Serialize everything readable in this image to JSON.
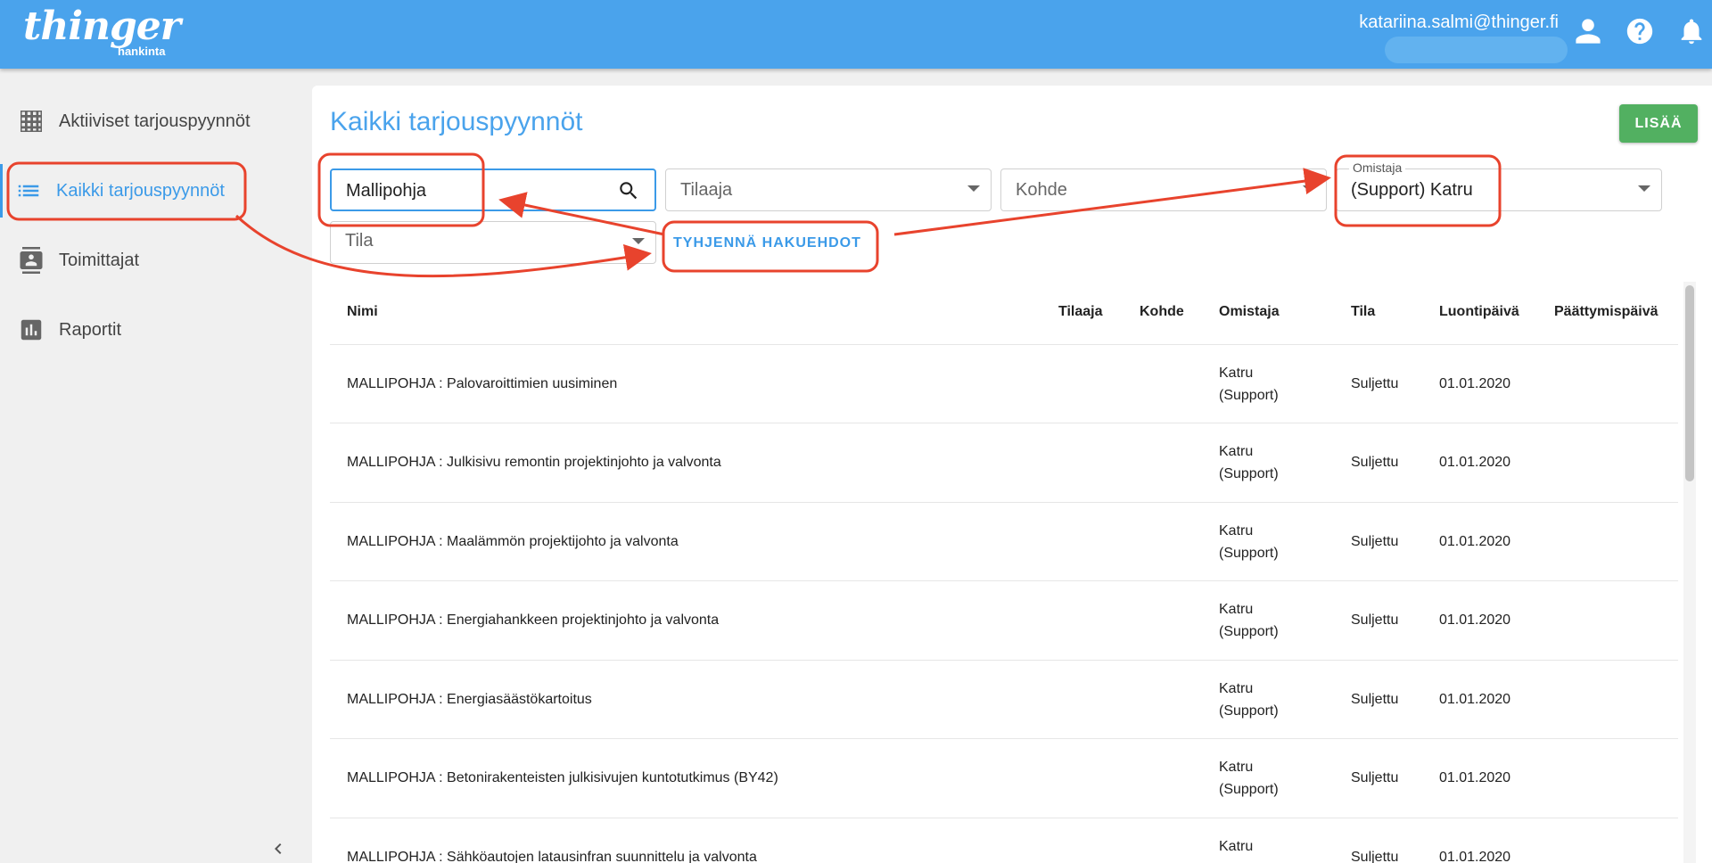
{
  "header": {
    "logo_text": "thinger",
    "logo_sub": "hankinta",
    "user_email": "katariina.salmi@thinger.fi",
    "icons": [
      "account-icon",
      "help-icon",
      "bell-icon"
    ]
  },
  "sidebar": {
    "items": [
      {
        "label": "Aktiiviset tarjouspyynnöt",
        "icon": "grid-icon",
        "active": false
      },
      {
        "label": "Kaikki tarjouspyynnöt",
        "icon": "list-icon",
        "active": true
      },
      {
        "label": "Toimittajat",
        "icon": "contacts-icon",
        "active": false
      },
      {
        "label": "Raportit",
        "icon": "bar-chart-icon",
        "active": false
      }
    ]
  },
  "main": {
    "title": "Kaikki tarjouspyynnöt",
    "add_button": "LISÄÄ",
    "filters": {
      "search_value": "Mallipohja",
      "tilaaja_placeholder": "Tilaaja",
      "kohde_placeholder": "Kohde",
      "omistaja_label": "Omistaja",
      "omistaja_value": "(Support) Katru",
      "tila_placeholder": "Tila"
    },
    "clear_button": "TYHJENNÄ HAKUEHDOT",
    "table": {
      "columns": [
        "Nimi",
        "Tilaaja",
        "Kohde",
        "Omistaja",
        "Tila",
        "Luontipäivä",
        "Päättymispäivä"
      ],
      "rows": [
        {
          "nimi": "MALLIPOHJA : Palovaroittimien uusiminen",
          "omistaja1": "Katru",
          "omistaja2": "(Support)",
          "tila": "Suljettu",
          "luonti": "01.01.2020"
        },
        {
          "nimi": "MALLIPOHJA : Julkisivu remontin projektinjohto ja valvonta",
          "omistaja1": "Katru",
          "omistaja2": "(Support)",
          "tila": "Suljettu",
          "luonti": "01.01.2020"
        },
        {
          "nimi": "MALLIPOHJA : Maalämmön projektijohto ja valvonta",
          "omistaja1": "Katru",
          "omistaja2": "(Support)",
          "tila": "Suljettu",
          "luonti": "01.01.2020"
        },
        {
          "nimi": "MALLIPOHJA : Energiahankkeen projektinjohto ja valvonta",
          "omistaja1": "Katru",
          "omistaja2": "(Support)",
          "tila": "Suljettu",
          "luonti": "01.01.2020"
        },
        {
          "nimi": "MALLIPOHJA : Energiasäästökartoitus",
          "omistaja1": "Katru",
          "omistaja2": "(Support)",
          "tila": "Suljettu",
          "luonti": "01.01.2020"
        },
        {
          "nimi": "MALLIPOHJA : Betonirakenteisten julkisivujen kuntotutkimus (BY42)",
          "omistaja1": "Katru",
          "omistaja2": "(Support)",
          "tila": "Suljettu",
          "luonti": "01.01.2020"
        },
        {
          "nimi": "MALLIPOHJA : Sähköautojen latausinfran suunnittelu ja valvonta",
          "omistaja1": "Katru",
          "omistaja2": "",
          "tila": "Suljettu",
          "luonti": "01.01.2020"
        }
      ]
    }
  },
  "colors": {
    "header": "#4aa3ec",
    "accent": "#3b9ae8",
    "add_button": "#52b061",
    "annotation": "#e8432d"
  }
}
